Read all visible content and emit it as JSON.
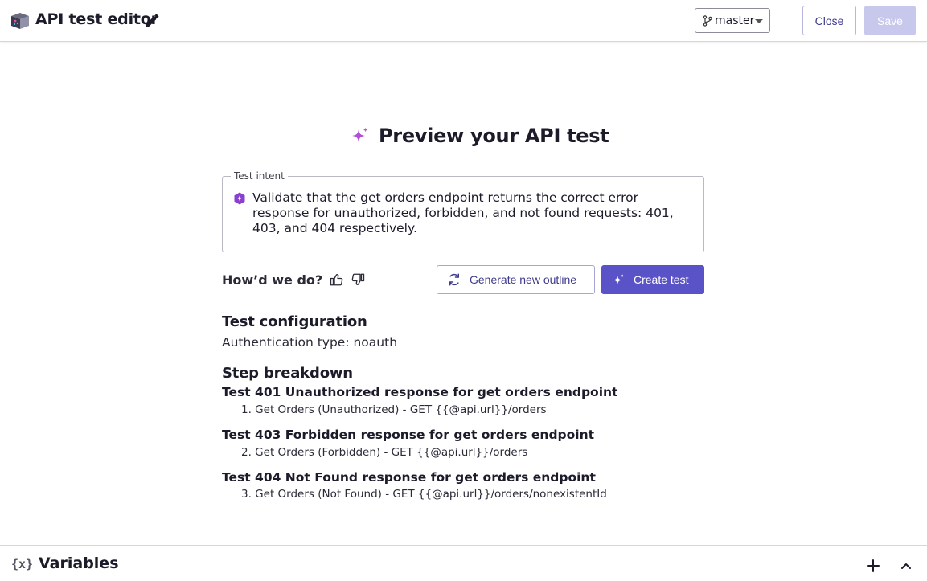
{
  "header": {
    "title": "API test editor",
    "branch": "master",
    "close_label": "Close",
    "save_label": "Save"
  },
  "main": {
    "heading": "Preview your API test",
    "intent": {
      "legend": "Test intent",
      "text": "Validate that the get orders endpoint returns the correct error response for unauthorized, forbidden, and not found requests: 401, 403, and 404 respectively."
    },
    "feedback_question": "How’d we do?",
    "generate_label": "Generate new outline",
    "create_label": "Create test",
    "config": {
      "heading": "Test configuration",
      "auth": "Authentication type: noauth"
    },
    "steps": {
      "heading": "Step breakdown",
      "items": [
        {
          "title": "Test 401 Unauthorized response for get orders endpoint",
          "detail": "1. Get Orders (Unauthorized) - GET {{@api.url}}/orders"
        },
        {
          "title": "Test 403 Forbidden response for get orders endpoint",
          "detail": "2. Get Orders (Forbidden) - GET {{@api.url}}/orders"
        },
        {
          "title": "Test 404 Not Found response for get orders endpoint",
          "detail": "3. Get Orders (Not Found) - GET {{@api.url}}/orders/nonexistentId"
        }
      ]
    }
  },
  "bottom": {
    "icon_text": "{x}",
    "title": "Variables"
  },
  "colors": {
    "accent": "#5a53c8",
    "accent_light": "#c8c7ec",
    "sparkle": "#b04fd6"
  },
  "icons": [
    "app-logo-icon",
    "pencil-icon",
    "branch-icon",
    "sparkle-icon",
    "ai-badge-icon",
    "thumbs-up-icon",
    "thumbs-down-icon",
    "refresh-icon",
    "plus-icon",
    "chevron-up-icon"
  ]
}
